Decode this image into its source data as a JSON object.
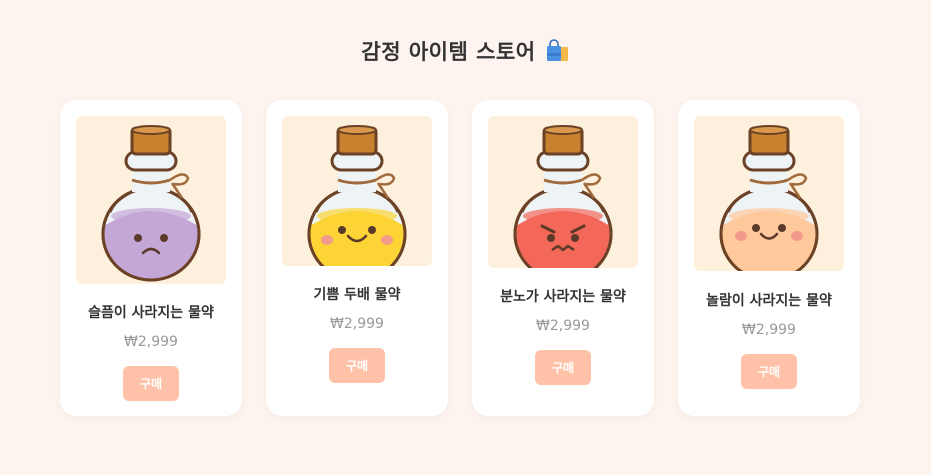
{
  "store": {
    "title": "감정 아이템 스토어",
    "title_icon": "shopping-bag-icon"
  },
  "products": [
    {
      "name": "슬픔이 사라지는 물약",
      "price": "₩2,999",
      "buy_label": "구매",
      "potion_color": "#c4a7d6",
      "face": "sad"
    },
    {
      "name": "기쁨 두배 물약",
      "price": "₩2,999",
      "buy_label": "구매",
      "potion_color": "#fcd435",
      "face": "happy"
    },
    {
      "name": "분노가 사라지는 물약",
      "price": "₩2,999",
      "buy_label": "구매",
      "potion_color": "#f4685a",
      "face": "angry"
    },
    {
      "name": "놀람이 사라지는 물약",
      "price": "₩2,999",
      "buy_label": "구매",
      "potion_color": "#ffc99c",
      "face": "calm"
    }
  ],
  "colors": {
    "background": "#fdf4ef",
    "card": "#ffffff",
    "button": "#ffc2a8",
    "image_bg": "#fdf0dc"
  }
}
